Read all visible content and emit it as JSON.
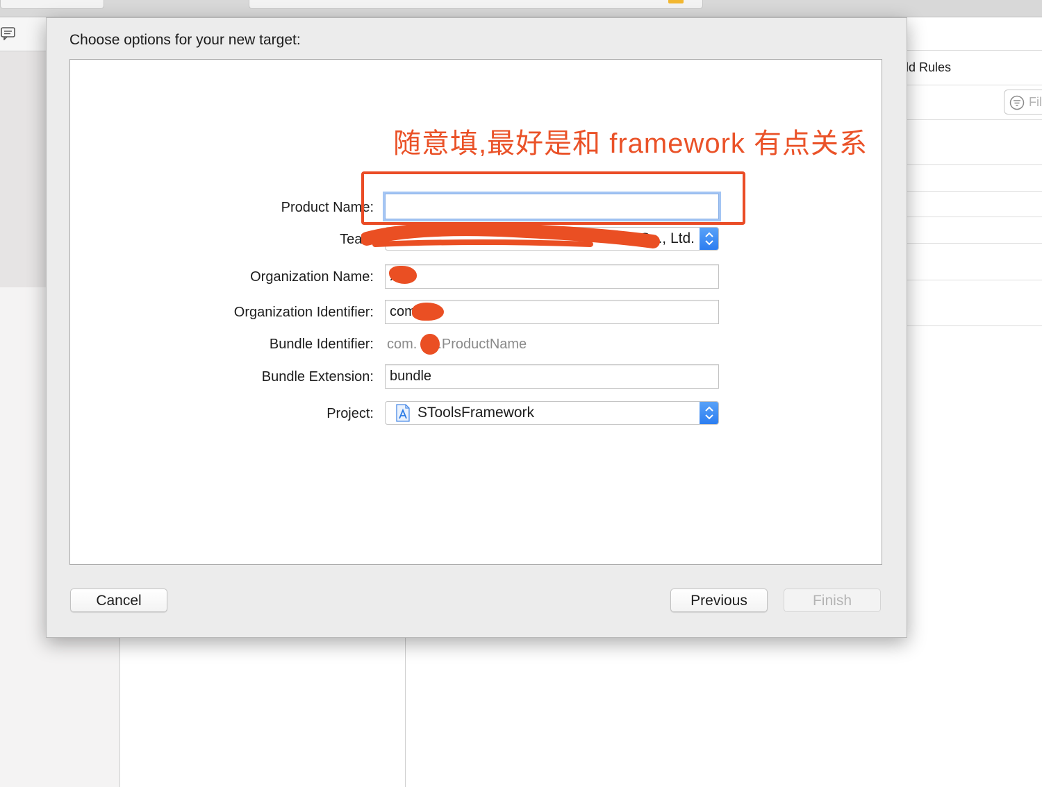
{
  "background": {
    "build_rules_label": "ild Rules",
    "filter_placeholder": "Fil"
  },
  "dialog": {
    "title": "Choose options for your new target:",
    "annotation": "随意填,最好是和 framework 有点关系",
    "form": {
      "product_name": {
        "label": "Product Name:",
        "value": ""
      },
      "team": {
        "label": "Team",
        "value": "…rse Co., Ltd."
      },
      "organization_name": {
        "label": "Organization Name:",
        "value": "X"
      },
      "organization_identifier": {
        "label": "Organization Identifier:",
        "value": "com"
      },
      "bundle_identifier": {
        "label": "Bundle Identifier:",
        "prefix": "com.",
        "suffix": ".ProductName"
      },
      "bundle_extension": {
        "label": "Bundle Extension:",
        "value": "bundle"
      },
      "project": {
        "label": "Project:",
        "value": "SToolsFramework"
      }
    },
    "buttons": {
      "cancel": "Cancel",
      "previous": "Previous",
      "finish": "Finish"
    }
  },
  "colors": {
    "annotation": "#ea5228",
    "stepper_blue": "#2b7cf0",
    "focus_ring": "#5a96eb"
  }
}
